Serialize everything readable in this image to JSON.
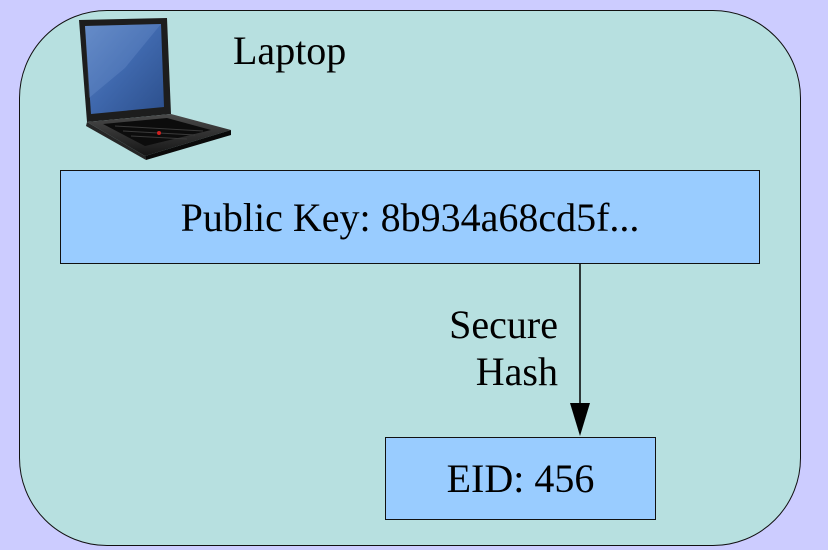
{
  "device": {
    "label": "Laptop",
    "icon": "laptop-icon"
  },
  "public_key": {
    "label": "Public Key: 8b934a68cd5f..."
  },
  "hash_step": {
    "line1": "Secure",
    "line2": "Hash"
  },
  "eid": {
    "label": "EID: 456"
  },
  "colors": {
    "page_background": "#ccccff",
    "device_panel": "#b7e0e0",
    "box_fill": "#99ccff",
    "stroke": "#111111"
  }
}
